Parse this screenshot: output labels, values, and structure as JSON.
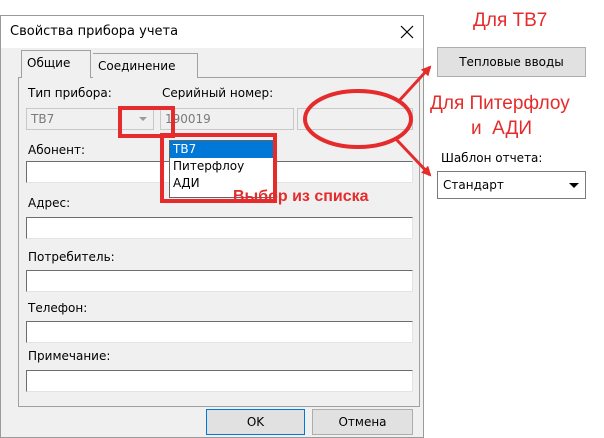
{
  "dialog": {
    "title": "Свойства прибора учета",
    "tabs": [
      "Общие",
      "Соединение"
    ],
    "device_type": {
      "label": "Тип прибора:",
      "value": "ТВ7"
    },
    "serial": {
      "label": "Серийный номер:",
      "value": "190019"
    },
    "fields": [
      {
        "label": "Абонент:",
        "value": ""
      },
      {
        "label": "Адрес:",
        "value": ""
      },
      {
        "label": "Потребитель:",
        "value": ""
      },
      {
        "label": "Телефон:",
        "value": ""
      },
      {
        "label": "Примечание:",
        "value": ""
      }
    ],
    "ok_label": "OK",
    "cancel_label": "Отмена"
  },
  "dropdown": {
    "options": [
      "ТВ7",
      "Питерфлоу",
      "АДИ"
    ],
    "selected": "ТВ7"
  },
  "side": {
    "heat_inputs_button": "Тепловые вводы",
    "report_template_label": "Шаблон отчета:",
    "report_template_value": "Стандарт"
  },
  "annotations": {
    "for_tv7": "Для ТВ7",
    "for_piterflow_line1": "Для Питерфлоу",
    "for_piterflow_line2": "и  АДИ",
    "select_from_list": "Выбор из списка"
  },
  "colors": {
    "annotation_red": "#e52b2b",
    "selection_blue": "#0078d7",
    "dialog_bg": "#f0f0f0"
  }
}
